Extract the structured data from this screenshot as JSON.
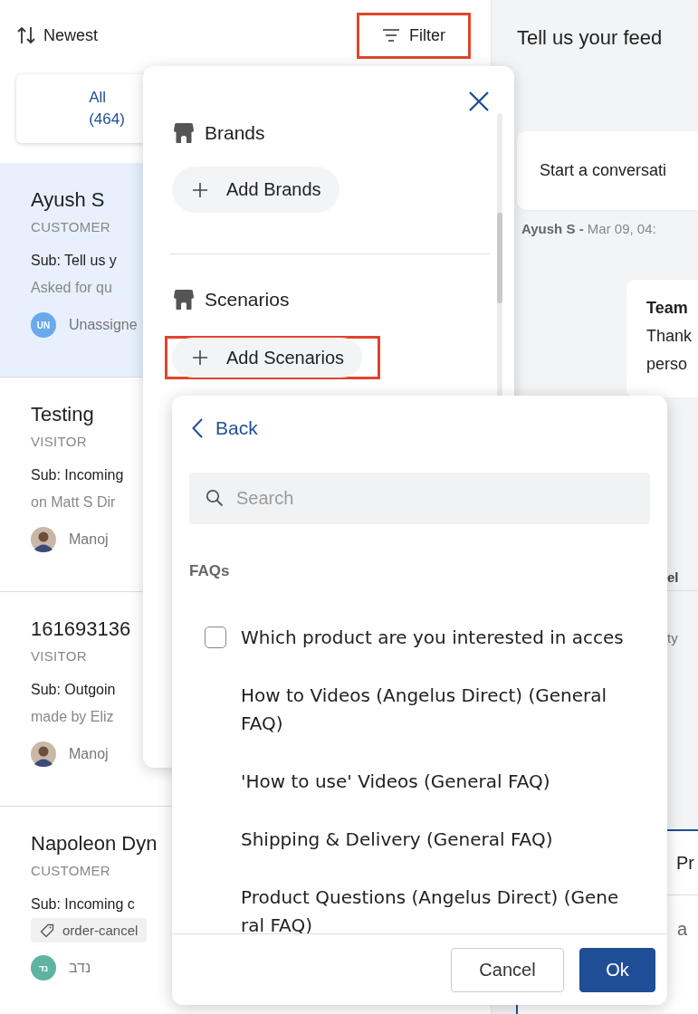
{
  "sort": {
    "label": "Newest"
  },
  "filter_button": {
    "label": "Filter",
    "highlighted": true
  },
  "tabs": [
    {
      "label": "All",
      "count": "(464)",
      "selected": true
    }
  ],
  "conversations": [
    {
      "name": "Ayush S",
      "role": "CUSTOMER",
      "subject": "Sub: Tell us y",
      "preview": "Asked for qu",
      "assignee": "Unassigne",
      "avatar": {
        "kind": "initials",
        "text": "UN",
        "color": "#6aa9ec"
      },
      "selected": true
    },
    {
      "name": "Testing",
      "role": "VISITOR",
      "subject": "Sub: Incoming",
      "preview": "on Matt S Dir",
      "assignee": "Manoj",
      "avatar": {
        "kind": "photo"
      },
      "selected": false
    },
    {
      "name": "161693136",
      "role": "VISITOR",
      "subject": "Sub: Outgoin",
      "preview": "made by Eliz",
      "assignee": "Manoj",
      "avatar": {
        "kind": "photo"
      },
      "selected": false
    },
    {
      "name": "Napoleon Dyn",
      "role": "CUSTOMER",
      "subject": "Sub: Incoming c",
      "tag": "order-cancel",
      "assignee": "נדב",
      "avatar": {
        "kind": "initials",
        "text": "נד",
        "color": "#5fb3a1"
      },
      "selected": false
    }
  ],
  "chat": {
    "title": "Tell us your feed",
    "first_message": "Start a conversati",
    "author": "Ayush S -",
    "time": "Mar 09, 04:",
    "reply": {
      "sender": "Team",
      "lines": [
        "Thank",
        "perso"
      ]
    },
    "note_sender": "el",
    "note_text": "ty",
    "panel_tab": "Pr",
    "panel_text": "a"
  },
  "filter_popup": {
    "sections": [
      {
        "title": "Brands",
        "button": "Add Brands",
        "highlighted": false
      },
      {
        "title": "Scenarios",
        "button": "Add Scenarios",
        "highlighted": true
      }
    ]
  },
  "scenario_popup": {
    "back": "Back",
    "search": {
      "placeholder": "Search"
    },
    "group": "FAQs",
    "items": [
      {
        "kind": "checkbox",
        "label": "Which product are you interested in acces",
        "checked": false
      },
      {
        "kind": "plain",
        "label": "How to Videos (Angelus Direct) (General FAQ)"
      },
      {
        "kind": "plain",
        "label": "'How to use' Videos (General FAQ)"
      },
      {
        "kind": "plain",
        "label": "Shipping & Delivery (General FAQ)"
      },
      {
        "kind": "plain",
        "label": "Product Questions (Angelus Direct) (General FAQ)"
      }
    ],
    "buttons": [
      {
        "label": "Cancel",
        "kind": "secondary"
      },
      {
        "label": "Ok",
        "kind": "primary"
      }
    ]
  }
}
